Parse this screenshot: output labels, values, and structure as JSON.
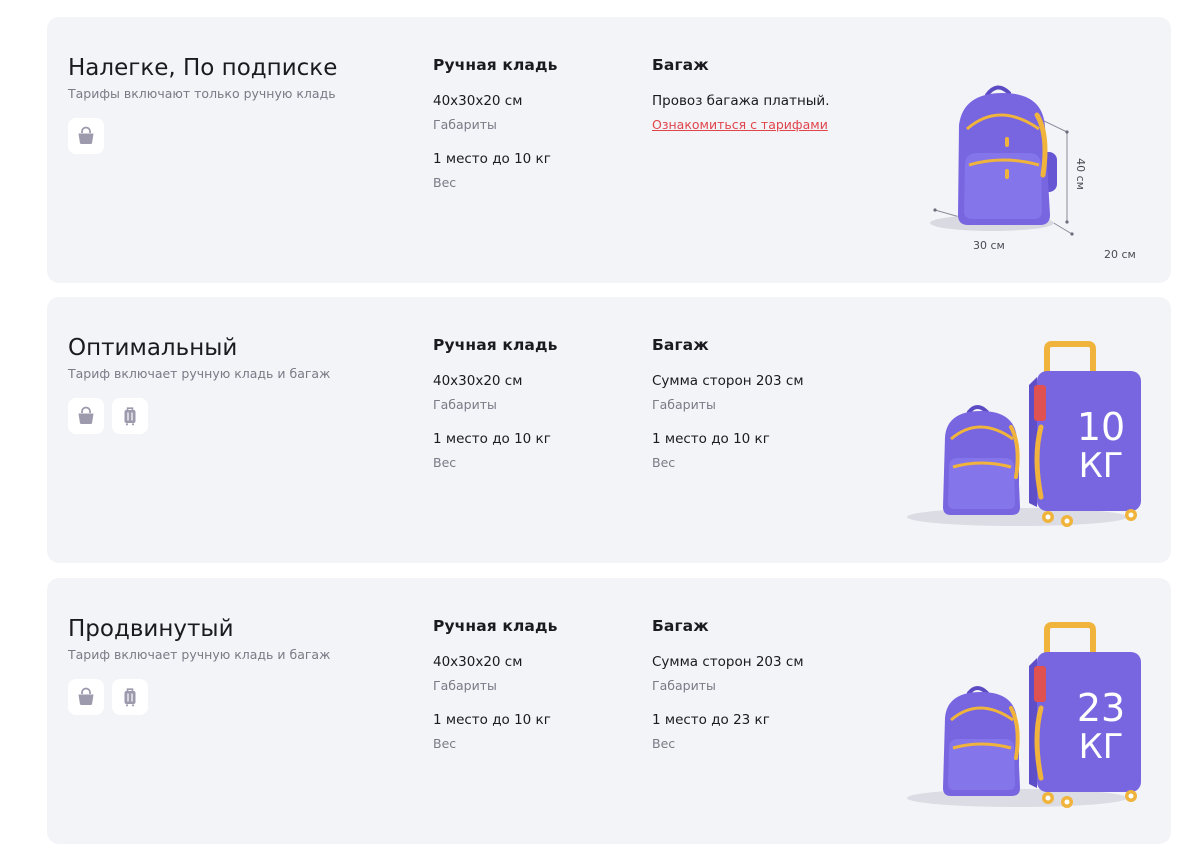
{
  "colors": {
    "card_bg": "#f3f4f8",
    "icon_grey": "#9d9aae",
    "bag_purple": "#7766e0",
    "bag_yellow": "#f0b43c",
    "link_red": "#e0454c"
  },
  "tariffs": [
    {
      "title": "Налегке, По подписке",
      "subtitle": "Тарифы включают только ручную кладь",
      "icons": [
        "hand-bag-icon"
      ],
      "hand": {
        "heading": "Ручная кладь",
        "size_value": "40x30x20 см",
        "size_label": "Габариты",
        "weight_value": "1 место до 10 кг",
        "weight_label": "Вес"
      },
      "baggage": {
        "heading": "Багаж",
        "note": "Провоз багажа платный.",
        "link": "Ознакомиться с тарифами"
      },
      "illustration": {
        "type": "backpack-dimensions-icon",
        "dim_height": "40 см",
        "dim_width": "30 см",
        "dim_depth": "20 см"
      }
    },
    {
      "title": "Оптимальный",
      "subtitle": "Тариф включает ручную кладь и багаж",
      "icons": [
        "hand-bag-icon",
        "suitcase-icon"
      ],
      "hand": {
        "heading": "Ручная кладь",
        "size_value": "40x30x20 см",
        "size_label": "Габариты",
        "weight_value": "1 место до 10 кг",
        "weight_label": "Вес"
      },
      "baggage": {
        "heading": "Багаж",
        "size_value": "Сумма сторон 203 см",
        "size_label": "Габариты",
        "weight_value": "1 место до 10 кг",
        "weight_label": "Вес"
      },
      "illustration": {
        "type": "suitcase-and-backpack-icon",
        "number": "10",
        "unit": "КГ"
      }
    },
    {
      "title": "Продвинутый",
      "subtitle": "Тариф включает ручную кладь и багаж",
      "icons": [
        "hand-bag-icon",
        "suitcase-icon"
      ],
      "hand": {
        "heading": "Ручная кладь",
        "size_value": "40x30x20 см",
        "size_label": "Габариты",
        "weight_value": "1 место до 10 кг",
        "weight_label": "Вес"
      },
      "baggage": {
        "heading": "Багаж",
        "size_value": "Сумма сторон 203 см",
        "size_label": "Габариты",
        "weight_value": "1 место до 23 кг",
        "weight_label": "Вес"
      },
      "illustration": {
        "type": "suitcase-and-backpack-icon",
        "number": "23",
        "unit": "КГ"
      }
    }
  ]
}
